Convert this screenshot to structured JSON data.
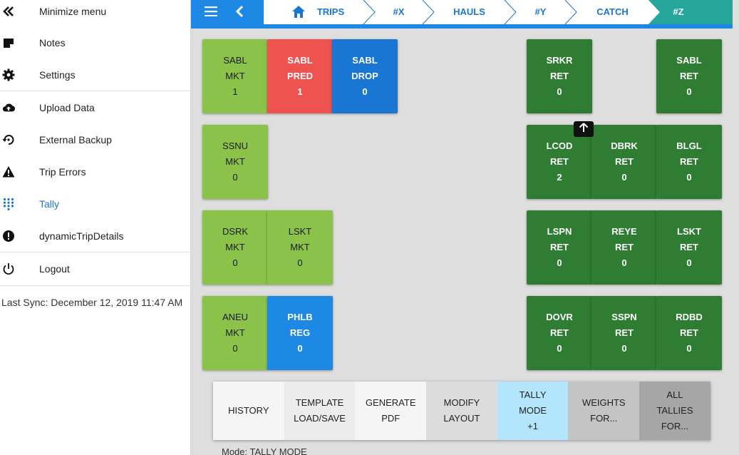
{
  "sidebar": {
    "items": [
      {
        "label": "Minimize menu",
        "icon": "double-chevron-left-icon"
      },
      {
        "label": "Notes",
        "icon": "note-icon"
      },
      {
        "label": "Settings",
        "icon": "gear-icon"
      },
      {
        "label": "Upload Data",
        "icon": "cloud-upload-icon"
      },
      {
        "label": "External Backup",
        "icon": "backup-restore-icon"
      },
      {
        "label": "Trip Errors",
        "icon": "warning-icon"
      },
      {
        "label": "Tally",
        "icon": "dialpad-icon"
      },
      {
        "label": "dynamicTripDetails",
        "icon": "alert-circle-icon"
      },
      {
        "label": "Logout",
        "icon": "power-icon"
      }
    ],
    "active": "Tally",
    "last_sync": "Last Sync: December 12, 2019 11:47 AM"
  },
  "header": {
    "menu_icon": "hamburger-icon",
    "back_icon": "chevron-left-icon",
    "breadcrumbs": [
      "TRIPS",
      "#X",
      "HAULS",
      "#Y",
      "CATCH",
      "#Z"
    ],
    "home_icon": "home-icon"
  },
  "colors": {
    "header": "#1e88e5",
    "mkt": "#8bc34a",
    "pred": "#ef5350",
    "drop": "#1976d2",
    "reg": "#1e88e5",
    "ret": "#2e7d32"
  },
  "tiles": [
    {
      "l1": "SABL",
      "l2": "MKT",
      "l3": "1"
    },
    {
      "l1": "SABL",
      "l2": "PRED",
      "l3": "1"
    },
    {
      "l1": "SABL",
      "l2": "DROP",
      "l3": "0"
    },
    {
      "l1": "SRKR",
      "l2": "RET",
      "l3": "0"
    },
    {
      "l1": "SABL",
      "l2": "RET",
      "l3": "0"
    },
    {
      "l1": "SSNU",
      "l2": "MKT",
      "l3": "0"
    },
    {
      "l1": "LCOD",
      "l2": "RET",
      "l3": "2"
    },
    {
      "l1": "DBRK",
      "l2": "RET",
      "l3": "0"
    },
    {
      "l1": "BLGL",
      "l2": "RET",
      "l3": "0"
    },
    {
      "l1": "DSRK",
      "l2": "MKT",
      "l3": "0"
    },
    {
      "l1": "LSKT",
      "l2": "MKT",
      "l3": "0"
    },
    {
      "l1": "LSPN",
      "l2": "RET",
      "l3": "0"
    },
    {
      "l1": "REYE",
      "l2": "RET",
      "l3": "0"
    },
    {
      "l1": "LSKT",
      "l2": "RET",
      "l3": "0"
    },
    {
      "l1": "ANEU",
      "l2": "MKT",
      "l3": "0"
    },
    {
      "l1": "PHLB",
      "l2": "REG",
      "l3": "0"
    },
    {
      "l1": "DOVR",
      "l2": "RET",
      "l3": "0"
    },
    {
      "l1": "SSPN",
      "l2": "RET",
      "l3": "0"
    },
    {
      "l1": "RDBD",
      "l2": "RET",
      "l3": "0"
    }
  ],
  "move_handle_icon": "arrow-up-icon",
  "toolbar": {
    "buttons": [
      {
        "lines": [
          "HISTORY"
        ],
        "bg": "#f5f5f5"
      },
      {
        "lines": [
          "TEMPLATE",
          "LOAD/SAVE"
        ],
        "bg": "#ececec"
      },
      {
        "lines": [
          "GENERATE",
          "PDF"
        ],
        "bg": "#f5f5f5"
      },
      {
        "lines": [
          "MODIFY",
          "LAYOUT"
        ],
        "bg": "#dcdcdc"
      },
      {
        "lines": [
          "TALLY",
          "MODE",
          "+1"
        ],
        "bg": "#b3e5fc"
      },
      {
        "lines": [
          "WEIGHTS",
          "FOR..."
        ],
        "bg": "#c4c4c4"
      },
      {
        "lines": [
          "ALL",
          "TALLIES",
          "FOR..."
        ],
        "bg": "#a6a6a6"
      }
    ]
  },
  "status": "Mode: TALLY MODE"
}
